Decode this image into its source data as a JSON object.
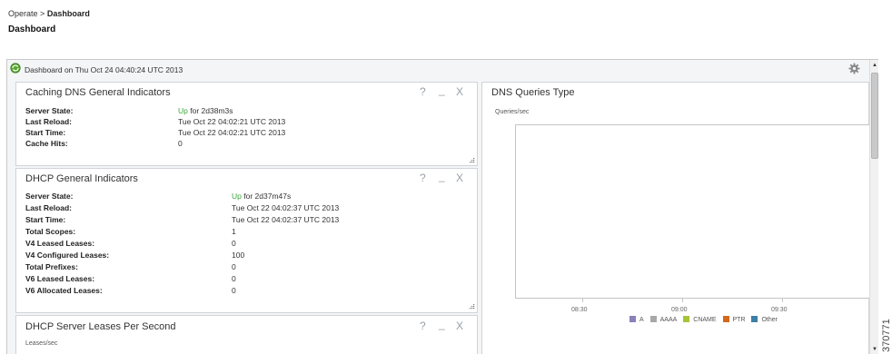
{
  "breadcrumb": {
    "parent": "Operate",
    "separator": ">",
    "current": "Dashboard"
  },
  "page_title": "Dashboard",
  "dashboard": {
    "title": "Dashboard on Thu Oct 24 04:40:24 UTC 2013"
  },
  "panel_controls": {
    "help": "?",
    "minimize": "_",
    "close": "X"
  },
  "caching_dns": {
    "title": "Caching DNS General Indicators",
    "rows": [
      {
        "label": "Server State:",
        "state": "Up",
        "value": "for 2d38m3s"
      },
      {
        "label": "Last Reload:",
        "value": "Tue Oct 22 04:02:21 UTC 2013"
      },
      {
        "label": "Start Time:",
        "value": "Tue Oct 22 04:02:21 UTC 2013"
      },
      {
        "label": "Cache Hits:",
        "value": "0"
      }
    ]
  },
  "dhcp": {
    "title": "DHCP General Indicators",
    "rows": [
      {
        "label": "Server State:",
        "state": "Up",
        "value": "for 2d37m47s"
      },
      {
        "label": "Last Reload:",
        "value": "Tue Oct 22 04:02:37 UTC 2013"
      },
      {
        "label": "Start Time:",
        "value": "Tue Oct 22 04:02:37 UTC 2013"
      },
      {
        "label": "Total Scopes:",
        "value": "1"
      },
      {
        "label": "V4 Leased Leases:",
        "value": "0"
      },
      {
        "label": "V4 Configured Leases:",
        "value": "100"
      },
      {
        "label": "Total Prefixes:",
        "value": "0"
      },
      {
        "label": "V6 Leased Leases:",
        "value": "0"
      },
      {
        "label": "V6 Allocated Leases:",
        "value": "0"
      }
    ]
  },
  "dhcp_leases": {
    "title": "DHCP Server Leases Per Second",
    "unit_label": "Leases/sec"
  },
  "dns_queries": {
    "title": "DNS Queries Type",
    "unit_label": "Queries/sec",
    "x_ticks": [
      "08:30",
      "09:00",
      "09:30"
    ],
    "legend": [
      {
        "name": "A",
        "color": "#8b80b8"
      },
      {
        "name": "AAAA",
        "color": "#a8a8a8"
      },
      {
        "name": "CNAME",
        "color": "#a6c43a"
      },
      {
        "name": "PTR",
        "color": "#d2691e"
      },
      {
        "name": "Other",
        "color": "#3d7fa6"
      }
    ]
  },
  "figure_id": "370771",
  "icons": {
    "dashboard": "dashboard-refresh-icon",
    "settings": "gear-icon"
  }
}
